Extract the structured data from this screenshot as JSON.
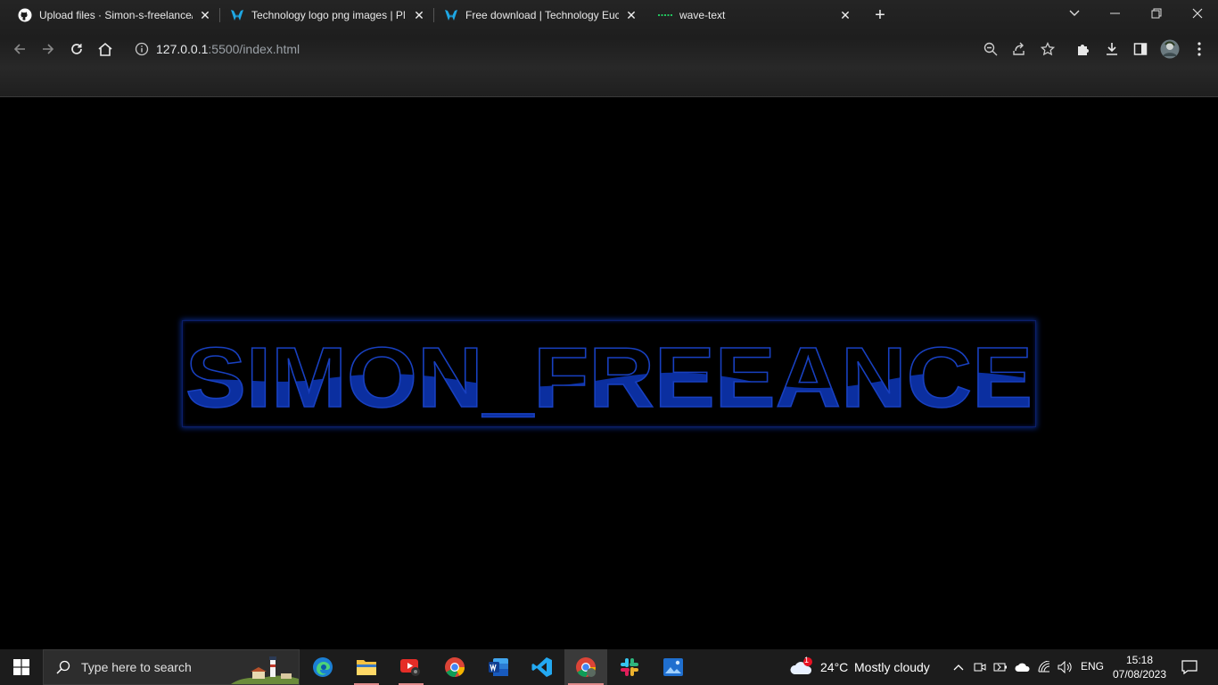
{
  "browser": {
    "tabs": [
      {
        "title": "Upload files · Simon-s-freelance/",
        "icon": "github-icon"
      },
      {
        "title": "Technology logo png images | PN",
        "icon": "pngtree-icon"
      },
      {
        "title": "Free download | Technology Eucl",
        "icon": "pngtree-icon"
      },
      {
        "title": "wave-text",
        "icon": "liveserver-icon",
        "active": true
      }
    ],
    "url_host": "127.0.0.1",
    "url_path": ":5500/index.html"
  },
  "page": {
    "wave_text": "SIMON_FREEANCE",
    "colors": {
      "fill": "#0b2fa0",
      "stroke": "#1840c0",
      "glow": "#0a2a8a"
    }
  },
  "taskbar": {
    "search_placeholder": "Type here to search",
    "weather_temp": "24°C",
    "weather_desc": "Mostly cloudy",
    "weather_badge": "1",
    "lang": "ENG",
    "time": "15:18",
    "date": "07/08/2023"
  }
}
